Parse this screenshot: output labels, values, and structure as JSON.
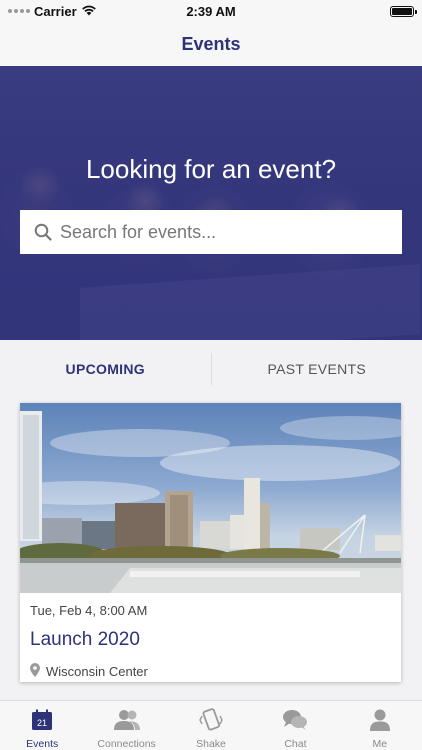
{
  "status_bar": {
    "carrier": "Carrier",
    "time": "2:39 AM"
  },
  "nav": {
    "title": "Events"
  },
  "hero": {
    "title": "Looking for an event?",
    "search_placeholder": "Search for events..."
  },
  "tabs": [
    {
      "label": "UPCOMING",
      "active": true
    },
    {
      "label": "PAST EVENTS",
      "active": false
    }
  ],
  "events": [
    {
      "date": "Tue, Feb 4, 8:00 AM",
      "name": "Launch 2020",
      "venue": "Wisconsin Center"
    }
  ],
  "tab_bar": {
    "items": [
      {
        "label": "Events",
        "icon": "calendar-icon",
        "badge": "21",
        "active": true
      },
      {
        "label": "Connections",
        "icon": "people-icon",
        "active": false
      },
      {
        "label": "Shake",
        "icon": "shake-phone-icon",
        "active": false
      },
      {
        "label": "Chat",
        "icon": "chat-bubbles-icon",
        "active": false
      },
      {
        "label": "Me",
        "icon": "person-icon",
        "active": false
      }
    ]
  },
  "colors": {
    "brand": "#2e3378",
    "hero_overlay": "#2d3078",
    "inactive": "#8a8a8a"
  }
}
